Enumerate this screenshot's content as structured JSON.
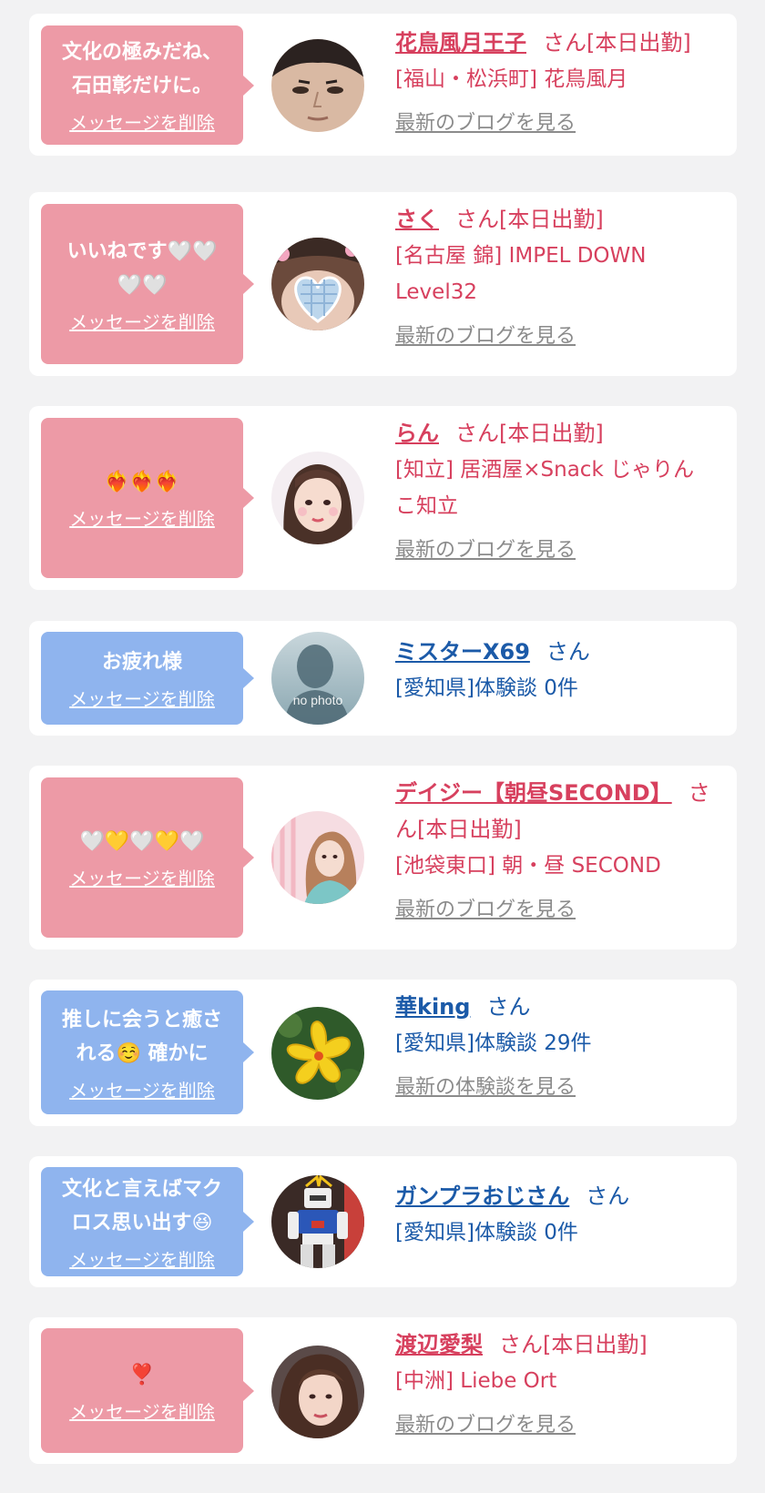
{
  "delete_label": "メッセージを削除",
  "colors": {
    "page_bg": "#f2f2f3",
    "pink_bubble": "#ed9aa6",
    "blue_bubble": "#8fb4ee",
    "pink_text": "#d7405e",
    "blue_text": "#1b5aa8",
    "link_gray": "#8b8b8b"
  },
  "messages": [
    {
      "bubble_text": "文化の極みだね、\n石田彰だけに。",
      "name": "花鳥風月王子",
      "suffix": "さん[本日出勤]",
      "shop": "[福山・松浜町] 花鳥風月",
      "link": "最新のブログを見る",
      "avatar": "man-face-photo"
    },
    {
      "bubble_text": "いいねです🤍🤍\n🤍🤍",
      "name": "さく",
      "suffix": "さん[本日出勤]",
      "shop": "[名古屋 錦] IMPEL DOWN\nLevel32",
      "link": "最新のブログを見る",
      "avatar": "girl-heart-sticker-photo"
    },
    {
      "bubble_text": "❤️‍🔥❤️‍🔥❤️‍🔥",
      "name": "らん",
      "suffix": "さん[本日出勤]",
      "shop": "[知立] 居酒屋×Snack じゃりん\nこ知立",
      "link": "最新のブログを見る",
      "avatar": "girl-photo"
    },
    {
      "bubble_text": "お疲れ様",
      "name": "ミスターX69",
      "suffix": "さん",
      "shop": "[愛知県]体験談 0件",
      "link": "",
      "avatar": "no-photo-silhouette",
      "avatar_text": "no photo"
    },
    {
      "bubble_text": "🤍💛🤍💛🤍",
      "name": "デイジー【朝昼SECOND】",
      "suffix": "さん[本日出勤]",
      "shop": "[池袋東口] 朝・昼 SECOND",
      "link": "最新のブログを見る",
      "avatar": "girl-photo-pink-wall"
    },
    {
      "bubble_text": "推しに会うと癒さ\nれる☺️ 確かに",
      "name": "華king",
      "suffix": "さん",
      "shop": "[愛知県]体験談 29件",
      "link": "最新の体験談を見る",
      "avatar": "yellow-hibiscus-photo"
    },
    {
      "bubble_text": "文化と言えばマク\nロス思い出す😆",
      "name": "ガンプラおじさん",
      "suffix": "さん",
      "shop": "[愛知県]体験談 0件",
      "link": "",
      "avatar": "gundam-model-photo"
    },
    {
      "bubble_text": "❣️",
      "name": "渡辺愛梨",
      "suffix": "さん[本日出勤]",
      "shop": "[中洲] Liebe Ort",
      "link": "最新のブログを見る",
      "avatar": "woman-photo"
    }
  ]
}
